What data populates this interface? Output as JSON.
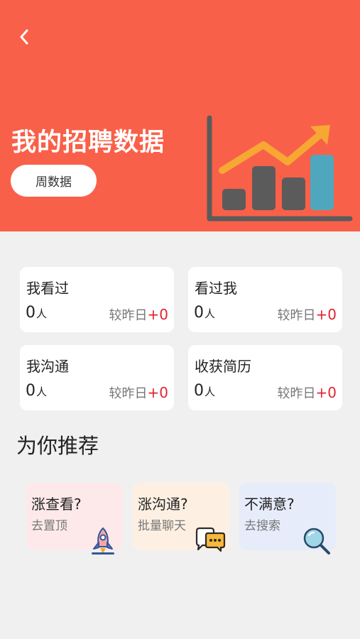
{
  "header": {
    "back_icon": "chevron-left-icon",
    "title": "我的招聘数据",
    "period_button": "周数据",
    "colors": {
      "background": "#f96049",
      "bars": "#5b5b5b",
      "highlight_bar": "#4fa7be",
      "trend_arrow": "#f7a733"
    }
  },
  "stats": [
    {
      "label": "我看过",
      "value": "0",
      "unit": "人",
      "compare_label": "较昨日",
      "delta": "+0"
    },
    {
      "label": "看过我",
      "value": "0",
      "unit": "人",
      "compare_label": "较昨日",
      "delta": "+0"
    },
    {
      "label": "我沟通",
      "value": "0",
      "unit": "人",
      "compare_label": "较昨日",
      "delta": "+0"
    },
    {
      "label": "收获简历",
      "value": "0",
      "unit": "人",
      "compare_label": "较昨日",
      "delta": "+0"
    }
  ],
  "recommend": {
    "title": "为你推荐",
    "cards": [
      {
        "title": "涨查看?",
        "subtitle": "去置顶",
        "icon": "rocket-icon",
        "bg": "#fde9ea"
      },
      {
        "title": "涨沟通?",
        "subtitle": "批量聊天",
        "icon": "chat-bubbles-icon",
        "bg": "#fdf0e2"
      },
      {
        "title": "不满意?",
        "subtitle": "去搜索",
        "icon": "magnifier-icon",
        "bg": "#e6ecfa"
      }
    ]
  },
  "colors": {
    "page_bg": "#f0f0f0",
    "delta": "#e0242f"
  }
}
